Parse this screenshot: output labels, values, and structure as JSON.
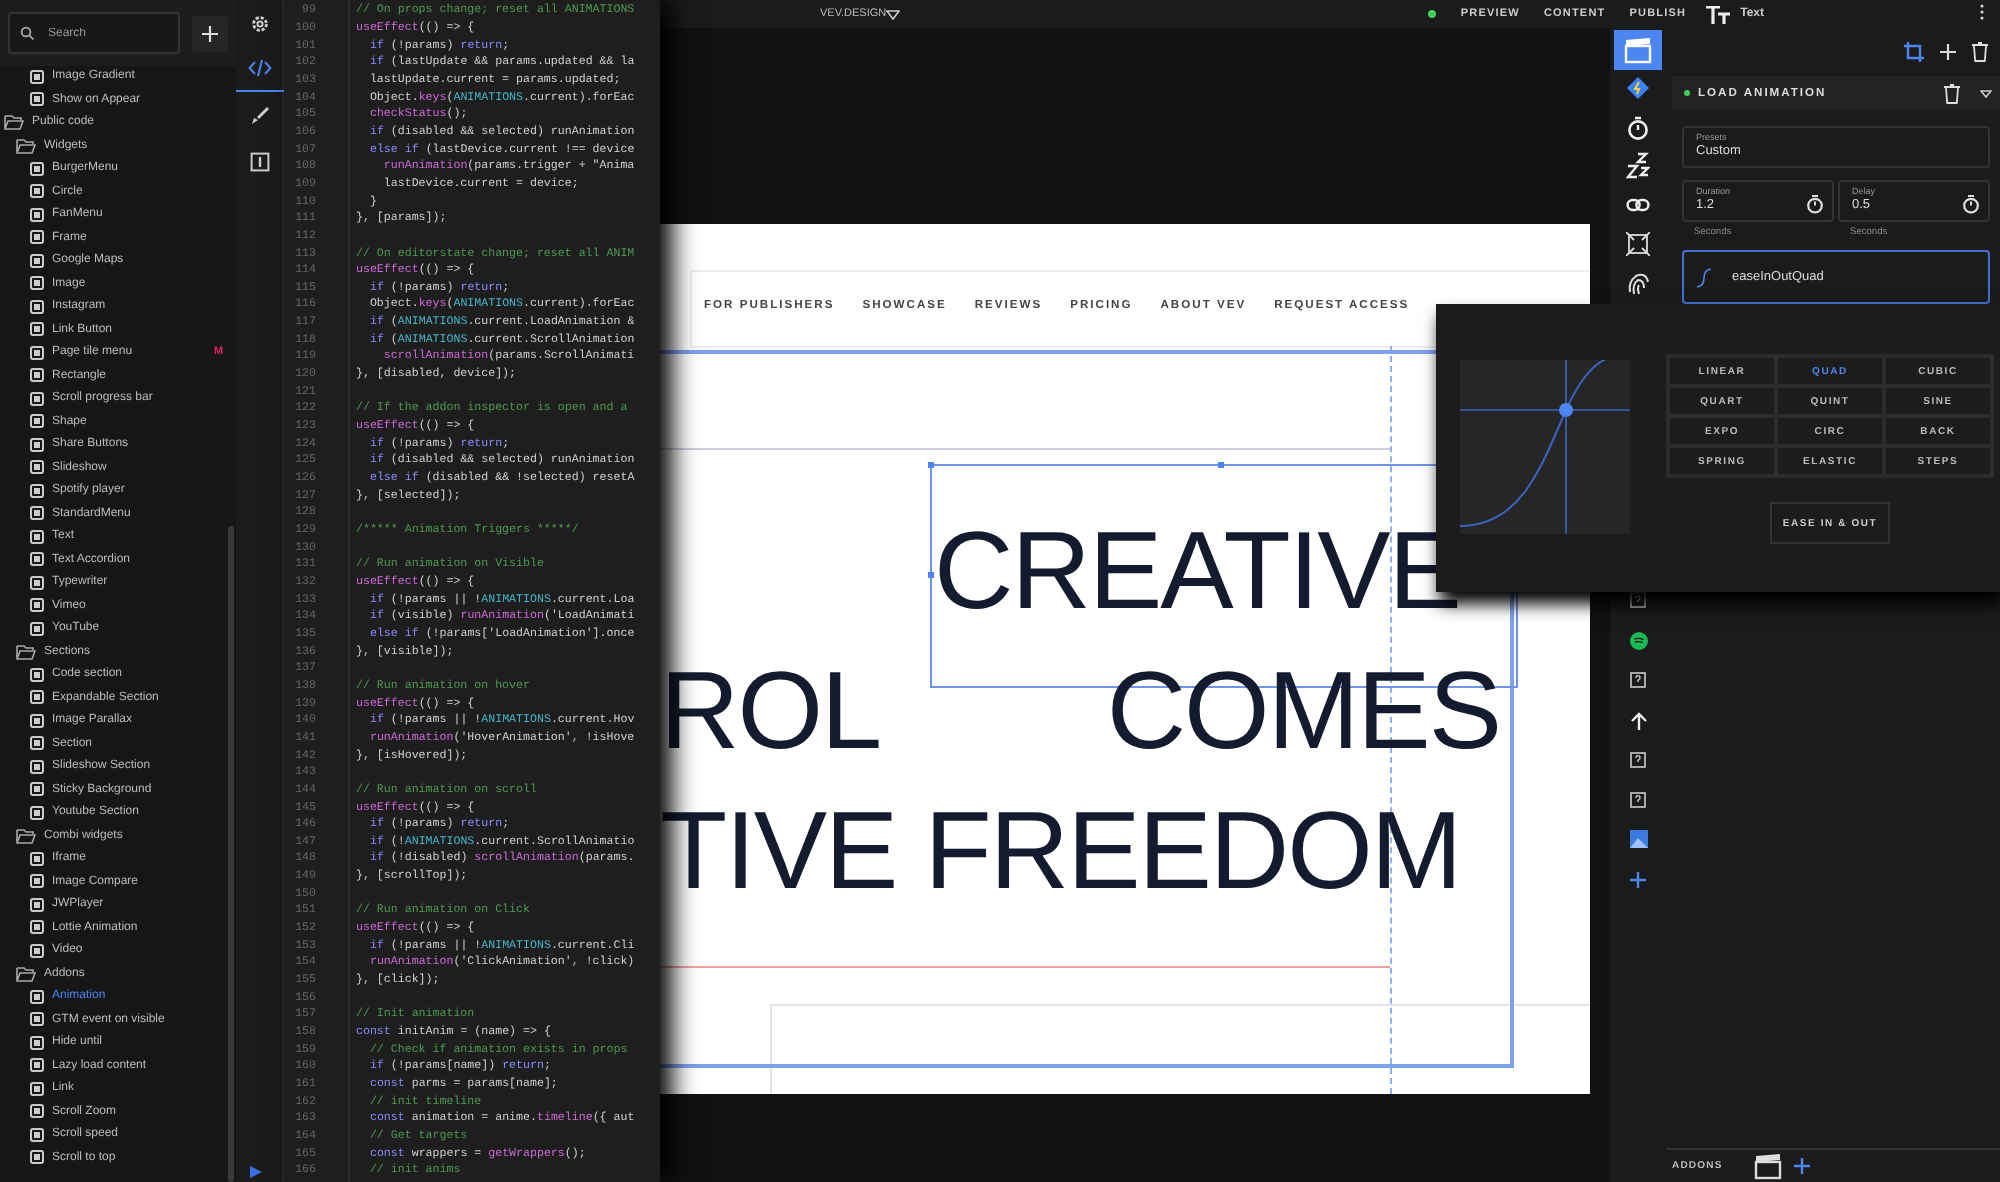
{
  "sidebar": {
    "search": {
      "placeholder": "Search"
    },
    "tree": [
      {
        "label": "Image Gradient",
        "kind": "item",
        "selected": false
      },
      {
        "label": "Show on Appear",
        "kind": "item",
        "selected": false
      },
      {
        "label": "Public code",
        "kind": "folder",
        "expanded": true,
        "selected": false,
        "children": [
          {
            "label": "Widgets",
            "kind": "folder",
            "expanded": true,
            "selected": false,
            "children": [
              {
                "label": "BurgerMenu",
                "kind": "item",
                "selected": false
              },
              {
                "label": "Circle",
                "kind": "item",
                "selected": false
              },
              {
                "label": "FanMenu",
                "kind": "item",
                "selected": false
              },
              {
                "label": "Frame",
                "kind": "item",
                "selected": false
              },
              {
                "label": "Google Maps",
                "kind": "item",
                "selected": false
              },
              {
                "label": "Image",
                "kind": "item",
                "selected": false
              },
              {
                "label": "Instagram",
                "kind": "item",
                "selected": false
              },
              {
                "label": "Link Button",
                "kind": "item",
                "selected": false
              },
              {
                "label": "Page tile menu",
                "kind": "item",
                "selected": false,
                "badge": "M"
              },
              {
                "label": "Rectangle",
                "kind": "item",
                "selected": false
              },
              {
                "label": "Scroll progress bar",
                "kind": "item",
                "selected": false
              },
              {
                "label": "Shape",
                "kind": "item",
                "selected": false
              },
              {
                "label": "Share Buttons",
                "kind": "item",
                "selected": false
              },
              {
                "label": "Slideshow",
                "kind": "item",
                "selected": false
              },
              {
                "label": "Spotify player",
                "kind": "item",
                "selected": false
              },
              {
                "label": "StandardMenu",
                "kind": "item",
                "selected": false
              },
              {
                "label": "Text",
                "kind": "item",
                "selected": false
              },
              {
                "label": "Text Accordion",
                "kind": "item",
                "selected": false
              },
              {
                "label": "Typewriter",
                "kind": "item",
                "selected": false
              },
              {
                "label": "Vimeo",
                "kind": "item",
                "selected": false
              },
              {
                "label": "YouTube",
                "kind": "item",
                "selected": false
              }
            ]
          },
          {
            "label": "Sections",
            "kind": "folder",
            "expanded": true,
            "selected": false,
            "children": [
              {
                "label": "Code section",
                "kind": "item",
                "selected": false
              },
              {
                "label": "Expandable Section",
                "kind": "item",
                "selected": false
              },
              {
                "label": "Image Parallax",
                "kind": "item",
                "selected": false
              },
              {
                "label": "Section",
                "kind": "item",
                "selected": false
              },
              {
                "label": "Slideshow Section",
                "kind": "item",
                "selected": false
              },
              {
                "label": "Sticky Background",
                "kind": "item",
                "selected": false
              },
              {
                "label": "Youtube Section",
                "kind": "item",
                "selected": false
              }
            ]
          },
          {
            "label": "Combi widgets",
            "kind": "folder",
            "expanded": true,
            "selected": false,
            "children": [
              {
                "label": "Iframe",
                "kind": "item",
                "selected": false
              },
              {
                "label": "Image Compare",
                "kind": "item",
                "selected": false
              },
              {
                "label": "JWPlayer",
                "kind": "item",
                "selected": false
              },
              {
                "label": "Lottie Animation",
                "kind": "item",
                "selected": false
              },
              {
                "label": "Video",
                "kind": "item",
                "selected": false
              }
            ]
          },
          {
            "label": "Addons",
            "kind": "folder",
            "expanded": true,
            "selected": false,
            "children": [
              {
                "label": "Animation",
                "kind": "item",
                "selected": true
              },
              {
                "label": "GTM event on visible",
                "kind": "item",
                "selected": false
              },
              {
                "label": "Hide until",
                "kind": "item",
                "selected": false
              },
              {
                "label": "Lazy load content",
                "kind": "item",
                "selected": false
              },
              {
                "label": "Link",
                "kind": "item",
                "selected": false
              },
              {
                "label": "Scroll Zoom",
                "kind": "item",
                "selected": false
              },
              {
                "label": "Scroll speed",
                "kind": "item",
                "selected": false
              },
              {
                "label": "Scroll to top",
                "kind": "item",
                "selected": false
              }
            ]
          }
        ]
      }
    ]
  },
  "tool_rail": [
    {
      "selected": false
    },
    {
      "selected": true
    },
    {
      "selected": false
    },
    {
      "selected": false
    }
  ],
  "code_editor": {
    "lines": [
      {
        "number": "99",
        "kind": "comment",
        "text": "// On props change; reset all ANIMATIONS"
      },
      {
        "number": "100",
        "kind": "code",
        "text": "useEffect(() => {"
      },
      {
        "number": "101",
        "kind": "code",
        "text": "  if (!params) return;"
      },
      {
        "number": "102",
        "kind": "code",
        "text": "  if (lastUpdate && params.updated && la"
      },
      {
        "number": "103",
        "kind": "code",
        "text": "  lastUpdate.current = params.updated;"
      },
      {
        "number": "104",
        "kind": "code",
        "text": "  Object.keys(ANIMATIONS.current).forEac"
      },
      {
        "number": "105",
        "kind": "code",
        "text": "  checkStatus();"
      },
      {
        "number": "106",
        "kind": "code",
        "text": "  if (disabled && selected) runAnimation"
      },
      {
        "number": "107",
        "kind": "code",
        "text": "  else if (lastDevice.current !== device"
      },
      {
        "number": "108",
        "kind": "code",
        "text": "    runAnimation(params.trigger + \"Anima"
      },
      {
        "number": "109",
        "kind": "code",
        "text": "    lastDevice.current = device;"
      },
      {
        "number": "110",
        "kind": "code",
        "text": "  }"
      },
      {
        "number": "111",
        "kind": "code",
        "text": "}, [params]);"
      },
      {
        "number": "112"
      },
      {
        "number": "113",
        "kind": "comment",
        "text": "// On editorstate change; reset all ANIM"
      },
      {
        "number": "114",
        "kind": "code",
        "text": "useEffect(() => {"
      },
      {
        "number": "115",
        "kind": "code",
        "text": "  if (!params) return;"
      },
      {
        "number": "116",
        "kind": "code",
        "text": "  Object.keys(ANIMATIONS.current).forEac"
      },
      {
        "number": "117",
        "kind": "code",
        "text": "  if (ANIMATIONS.current.LoadAnimation &"
      },
      {
        "number": "118",
        "kind": "code",
        "text": "  if (ANIMATIONS.current.ScrollAnimation"
      },
      {
        "number": "119",
        "kind": "code",
        "text": "    scrollAnimation(params.ScrollAnimati"
      },
      {
        "number": "120",
        "kind": "code",
        "text": "}, [disabled, device]);"
      },
      {
        "number": "121"
      },
      {
        "number": "122",
        "kind": "comment",
        "text": "// If the addon inspector is open and a"
      },
      {
        "number": "123",
        "kind": "code",
        "text": "useEffect(() => {"
      },
      {
        "number": "124",
        "kind": "code",
        "text": "  if (!params) return;"
      },
      {
        "number": "125",
        "kind": "code",
        "text": "  if (disabled && selected) runAnimation"
      },
      {
        "number": "126",
        "kind": "code",
        "text": "  else if (disabled && !selected) resetA"
      },
      {
        "number": "127",
        "kind": "code",
        "text": "}, [selected]);"
      },
      {
        "number": "128"
      },
      {
        "number": "129",
        "kind": "comment",
        "text": "/***** Animation Triggers *****/"
      },
      {
        "number": "130"
      },
      {
        "number": "131",
        "kind": "comment",
        "text": "// Run animation on Visible"
      },
      {
        "number": "132",
        "kind": "code",
        "text": "useEffect(() => {"
      },
      {
        "number": "133",
        "kind": "code",
        "text": "  if (!params || !ANIMATIONS.current.Loa"
      },
      {
        "number": "134",
        "kind": "code",
        "text": "  if (visible) runAnimation('LoadAnimati"
      },
      {
        "number": "135",
        "kind": "code",
        "text": "  else if (!params['LoadAnimation'].once"
      },
      {
        "number": "136",
        "kind": "code",
        "text": "}, [visible]);"
      },
      {
        "number": "137"
      },
      {
        "number": "138",
        "kind": "comment",
        "text": "// Run animation on hover"
      },
      {
        "number": "139",
        "kind": "code",
        "text": "useEffect(() => {"
      },
      {
        "number": "140",
        "kind": "code",
        "text": "  if (!params || !ANIMATIONS.current.Hov"
      },
      {
        "number": "141",
        "kind": "code",
        "text": "  runAnimation('HoverAnimation', !isHove"
      },
      {
        "number": "142",
        "kind": "code",
        "text": "}, [isHovered]);"
      },
      {
        "number": "143"
      },
      {
        "number": "144",
        "kind": "comment",
        "text": "// Run animation on scroll"
      },
      {
        "number": "145",
        "kind": "code",
        "text": "useEffect(() => {"
      },
      {
        "number": "146",
        "kind": "code",
        "text": "  if (!params) return;"
      },
      {
        "number": "147",
        "kind": "code",
        "text": "  if (!ANIMATIONS.current.ScrollAnimatio"
      },
      {
        "number": "148",
        "kind": "code",
        "text": "  if (!disabled) scrollAnimation(params."
      },
      {
        "number": "149",
        "kind": "code",
        "text": "}, [scrollTop]);"
      },
      {
        "number": "150"
      },
      {
        "number": "151",
        "kind": "comment",
        "text": "// Run animation on Click"
      },
      {
        "number": "152",
        "kind": "code",
        "text": "useEffect(() => {"
      },
      {
        "number": "153",
        "kind": "code",
        "text": "  if (!params || !ANIMATIONS.current.Cli"
      },
      {
        "number": "154",
        "kind": "code",
        "text": "  runAnimation('ClickAnimation', !click)"
      },
      {
        "number": "155",
        "kind": "code",
        "text": "}, [click]);"
      },
      {
        "number": "156"
      },
      {
        "number": "157",
        "kind": "comment",
        "text": "// Init animation"
      },
      {
        "number": "158",
        "kind": "code",
        "text": "const initAnim = (name) => {"
      },
      {
        "number": "159",
        "kind": "comment",
        "text": "  // Check if animation exists in props"
      },
      {
        "number": "160",
        "kind": "code",
        "text": "  if (!params[name]) return;"
      },
      {
        "number": "161",
        "kind": "code",
        "text": "  const parms = params[name];"
      },
      {
        "number": "162",
        "kind": "comment",
        "text": "  // init timeline"
      },
      {
        "number": "163",
        "kind": "code",
        "text": "  const animation = anime.timeline({ aut"
      },
      {
        "number": "164",
        "kind": "comment",
        "text": "  // Get targets"
      },
      {
        "number": "165",
        "kind": "code",
        "text": "  const wrappers = getWrappers();"
      },
      {
        "number": "166",
        "kind": "comment",
        "text": "  // init anims"
      }
    ]
  },
  "top_bar": {
    "site": "VEV.DESIGN",
    "actions": [
      "PREVIEW",
      "CONTENT",
      "PUBLISH"
    ],
    "element": "Text"
  },
  "canvas": {
    "nav": [
      "FOR PUBLISHERS",
      "SHOWCASE",
      "REVIEWS",
      "PRICING",
      "ABOUT VEV",
      "REQUEST ACCESS"
    ],
    "headline": [
      {
        "words": [
          "CREATIVE"
        ]
      },
      {
        "words": [
          "ROL",
          "COMES"
        ]
      },
      {
        "words": [
          "TIVE",
          "FREEDOM"
        ]
      }
    ]
  },
  "addon_rail": [
    {
      "selected": true
    },
    {
      "selected": false
    },
    {
      "selected": false
    },
    {
      "selected": false
    },
    {
      "selected": false
    },
    {
      "selected": false
    },
    {
      "selected": false
    }
  ],
  "addon_panel": {
    "title": "LOAD ANIMATION",
    "presets": {
      "label": "Presets",
      "value": "Custom"
    },
    "duration": {
      "label": "Duration",
      "value": "1.2",
      "unit": "Seconds"
    },
    "delay": {
      "label": "Delay",
      "value": "0.5",
      "unit": "Seconds"
    },
    "easing": {
      "value": "easeInOutQuad"
    }
  },
  "easing_popup": {
    "options": [
      {
        "label": "LINEAR",
        "selected": false
      },
      {
        "label": "QUAD",
        "selected": true
      },
      {
        "label": "CUBIC",
        "selected": false
      },
      {
        "label": "QUART",
        "selected": false
      },
      {
        "label": "QUINT",
        "selected": false
      },
      {
        "label": "SINE",
        "selected": false
      },
      {
        "label": "EXPO",
        "selected": false
      },
      {
        "label": "CIRC",
        "selected": false
      },
      {
        "label": "BACK",
        "selected": false
      },
      {
        "label": "SPRING",
        "selected": false
      },
      {
        "label": "ELASTIC",
        "selected": false
      },
      {
        "label": "STEPS",
        "selected": false
      }
    ],
    "mode": "EASE IN & OUT"
  },
  "bottom_bar": {
    "label": "ADDONS"
  }
}
